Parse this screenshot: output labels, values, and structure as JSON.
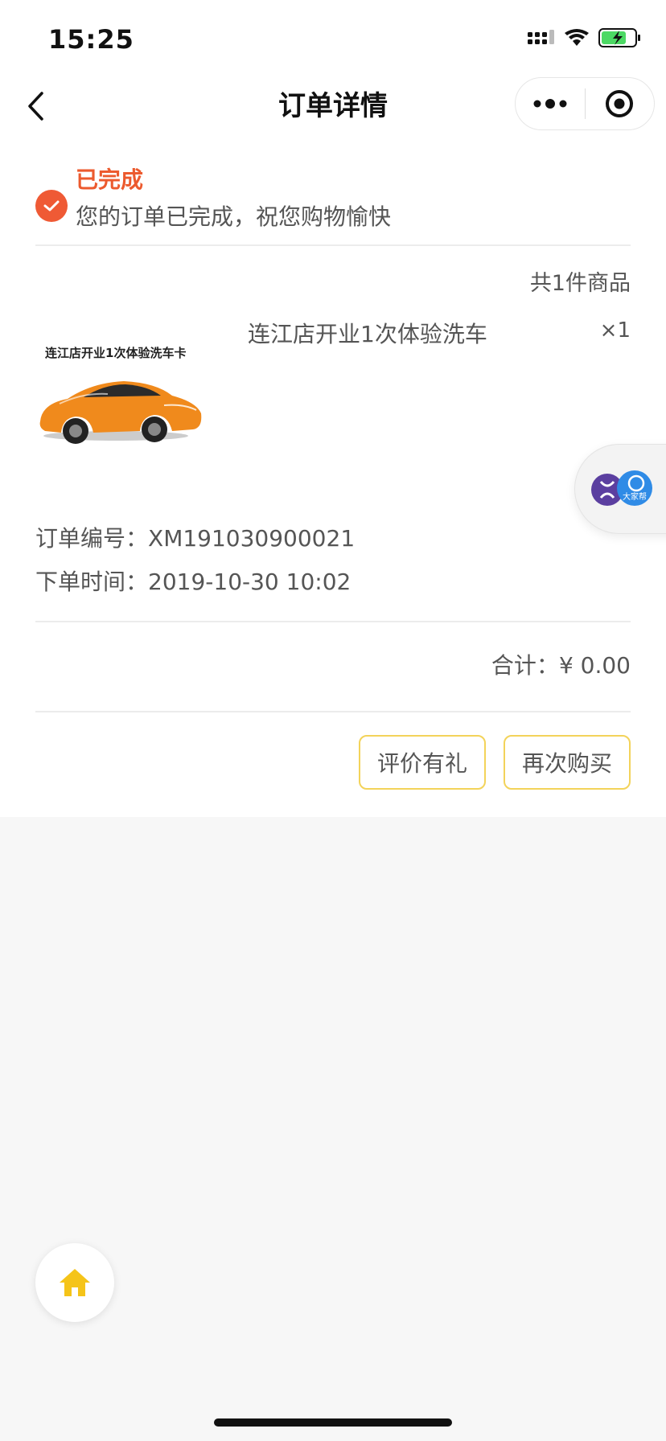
{
  "status_bar": {
    "time": "15:25"
  },
  "nav": {
    "title": "订单详情"
  },
  "order_status": {
    "title": "已完成",
    "description": "您的订单已完成，祝您购物愉快",
    "accent_color": "#ec5a2e"
  },
  "items": {
    "count_text": "共1件商品",
    "product": {
      "image_caption": "连江店开业1次体验洗车卡",
      "name": "连江店开业1次体验洗车",
      "qty": "×1"
    }
  },
  "order_info": {
    "number_label": "订单编号：",
    "number_value": "XM191030900021",
    "time_label": "下单时间：",
    "time_value": "2019-10-30 10:02"
  },
  "total": {
    "label": "合计：",
    "value": "¥ 0.00"
  },
  "actions": {
    "review_label": "评价有礼",
    "rebuy_label": "再次购买",
    "button_border_color": "#f3d35a"
  },
  "floating_widget": {
    "badge_text": "大家帮"
  },
  "icons": {
    "back": "chevron-left-icon",
    "more": "more-dots-icon",
    "close": "target-icon",
    "status": "check-icon",
    "home": "home-icon"
  }
}
